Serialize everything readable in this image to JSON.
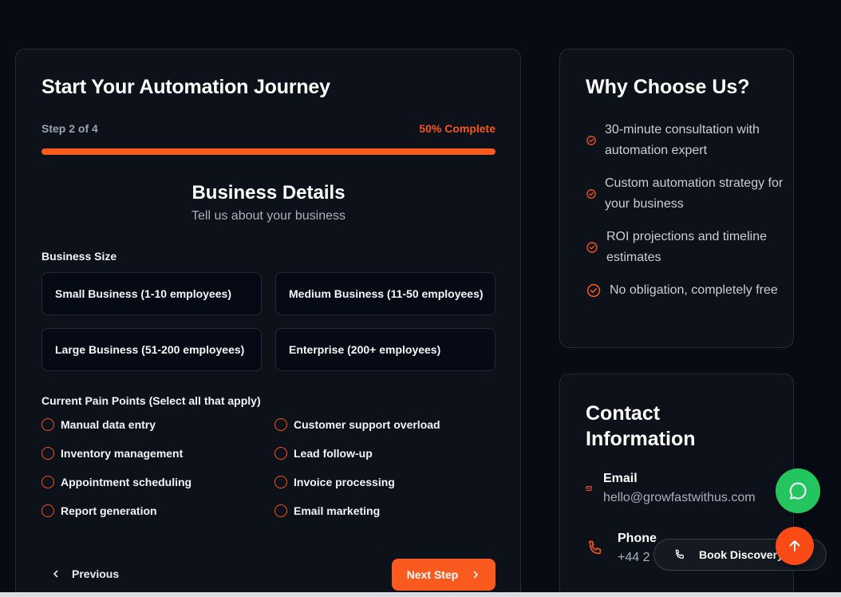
{
  "form": {
    "title": "Start Your Automation Journey",
    "step_text": "Step 2 of 4",
    "progress_text": "50% Complete",
    "progress_fraction": 0.5,
    "section_title": "Business Details",
    "section_subtitle": "Tell us about your business",
    "business_size_label": "Business Size",
    "business_sizes": [
      "Small Business (1-10 employees)",
      "Medium Business (11-50 employees)",
      "Large Business (51-200 employees)",
      "Enterprise (200+ employees)"
    ],
    "pain_points_label": "Current Pain Points (Select all that apply)",
    "pain_points": [
      "Manual data entry",
      "Customer support overload",
      "Inventory management",
      "Lead follow-up",
      "Appointment scheduling",
      "Invoice processing",
      "Report generation",
      "Email marketing"
    ],
    "previous_label": "Previous",
    "next_label": "Next Step"
  },
  "why": {
    "title": "Why Choose Us?",
    "items": [
      "30-minute consultation with automation expert",
      "Custom automation strategy for your business",
      "ROI projections and timeline estimates",
      "No obligation, completely free"
    ]
  },
  "contact": {
    "title": "Contact Information",
    "email_label": "Email",
    "email_value": "hello@growfastwithus.com",
    "phone_label": "Phone",
    "phone_value": "+44 2"
  },
  "floating": {
    "book_label": "Book Discovery"
  },
  "colors": {
    "accent": "#fa5a1e",
    "whatsapp": "#22c55e",
    "background": "#070b14",
    "card": "#0d1119"
  },
  "icons": {
    "check": "check-circle-icon",
    "email": "mail-icon",
    "phone": "phone-icon",
    "whatsapp": "chat-bubble-icon",
    "scroll_top": "arrow-up-icon"
  }
}
